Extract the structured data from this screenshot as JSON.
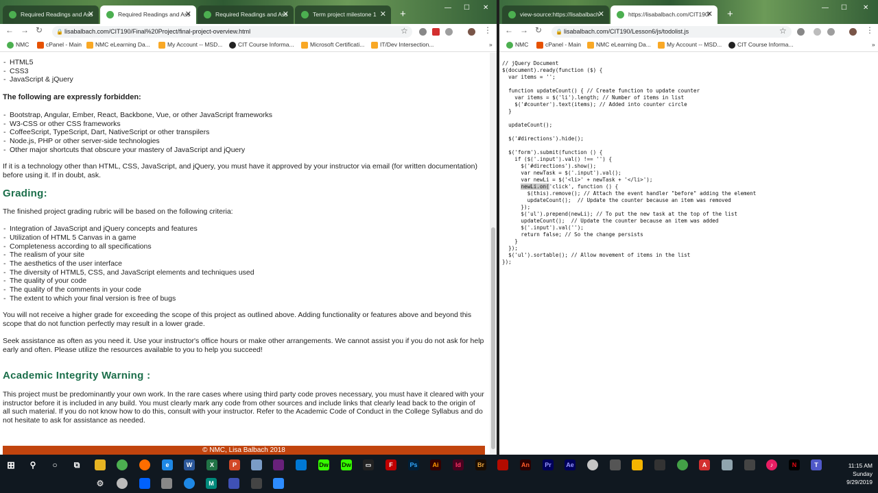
{
  "left_window": {
    "tabs": [
      {
        "label": "Required Readings and Ass"
      },
      {
        "label": "Required Readings and Ass"
      },
      {
        "label": "Required Readings and Ass"
      },
      {
        "label": "Term project milestone 1"
      }
    ],
    "url": "lisabalbach.com/CIT190/Final%20Project/final-project-overview.html",
    "bookmarks": [
      "NMC",
      "cPanel - Main",
      "NMC eLearning Da...",
      "My Account -- MSD...",
      "CIT Course Informa...",
      "Microsoft Certificati...",
      "IT/Dev Intersection..."
    ],
    "list1": [
      "HTML5",
      "CSS3",
      "JavaScript & jQuery"
    ],
    "forbidden_heading": "The following are expressly forbidden:",
    "forbidden": [
      "Bootstrap, Angular, Ember, React, Backbone, Vue, or other JavaScript frameworks",
      "W3-CSS or other CSS frameworks",
      "CoffeeScript, TypeScript, Dart, NativeScript or other transpilers",
      "Node.js, PHP or other server-side technologies",
      "Other major shortcuts that obscure your mastery of JavaScript and jQuery"
    ],
    "approval_text": "If it is a technology other than HTML, CSS, JavaScript, and jQuery, you must have it approved by your instructor via email (for written documentation) before using it. If in doubt, ask.",
    "grading_heading": "Grading:",
    "grading_intro": "The finished project grading rubric will be based on the following criteria:",
    "criteria": [
      "Integration of JavaScript and jQuery concepts and features",
      "Utilization of HTML 5 Canvas in a game",
      "Completeness according to all specifications",
      "The realism of your site",
      "The aesthetics of the user interface",
      "The diversity of HTML5, CSS, and JavaScript elements and techniques used",
      "The quality of your code",
      "The quality of the comments in your code",
      "The extent to which your final version is free of bugs"
    ],
    "scope_text": "You will not receive a higher grade for exceeding the scope of this project as outlined above.  Adding functionality or features above and beyond this scope that  do not function perfectly may result in a lower grade.",
    "assist_text": "Seek assistance as often as you need it.  Use your instructor's office hours or make other arrangements.  We cannot assist you if you do not ask for help early and often.  Please utilize the resources available to you to help you succeed!",
    "integrity_heading": "Academic Integrity Warning :",
    "integrity_text": "This project must be predominantly your own work. In the rare cases where using third party code proves necessary, you must have it cleared with your instructor before it is included in any build. You must clearly mark any code from other sources and include links that clearly lead back to the origin of all such material. If you do not know how to do this, consult with your instructor. Refer to the Academic Code of Conduct in the College Syllabus and do not hesitate to ask for assistance as needed.",
    "footer": "© NMC, Lisa Balbach 2018"
  },
  "right_window": {
    "tabs": [
      {
        "label": "view-source:https://lisabalbach"
      },
      {
        "label": "https://lisabalbach.com/CIT190/"
      }
    ],
    "url": "lisabalbach.com/CIT190/Lesson6/js/todolist.js",
    "bookmarks": [
      "NMC",
      "cPanel - Main",
      "NMC eLearning Da...",
      "My Account -- MSD...",
      "CIT Course Informa..."
    ],
    "code_before": "// jQuery Document\n$(document).ready(function ($) {\n  var items = '';\n\n  function updateCount() { // Create function to update counter\n    var items = $('li').length; // Number of items in list\n    $('#counter').text(items); // Added into counter circle\n  }\n\n  updateCount();\n\n  $('#directions').hide();\n\n  $('form').submit(function () {\n    if ($('.input').val() !== '') {\n      $('#directions').show();\n      var newTask = $('.input').val();\n      var newLi = $('<li>' + newTask + '</li>');\n      ",
    "code_highlight": "newLi.on(",
    "code_after": "'click', function () {\n        $(this).remove(); // Attach the event handler \"before\" adding the element\n        updateCount();  // Update the counter because an item was removed\n      });\n      $('ul').prepend(newLi); // To put the new task at the top of the list\n      updateCount();  // Update the counter because an item was added\n      $('.input').val('');\n      return false; // So the change persists\n    }\n  });\n  $('ul').sortable(); // Allow movement of items in the list\n});"
  },
  "taskbar": {
    "time": "11:15 AM",
    "day": "Sunday",
    "date": "9/29/2019"
  }
}
